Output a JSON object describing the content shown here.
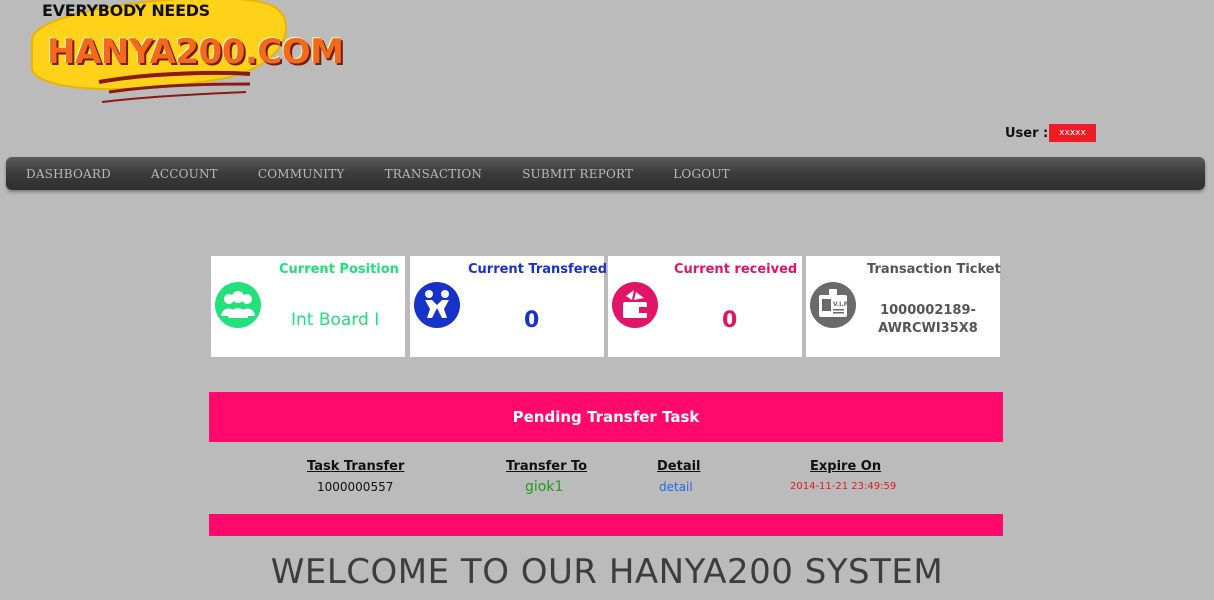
{
  "header": {
    "logo_tagline": "EVERYBODY NEEDS",
    "logo_word": "HANYA200.COM",
    "user_label": "User :",
    "user_name": "xxxxx"
  },
  "nav": {
    "items": [
      "DASHBOARD",
      "ACCOUNT",
      "COMMUNITY",
      "TRANSACTION",
      "SUBMIT REPORT",
      "LOGOUT"
    ]
  },
  "cards": [
    {
      "title": "Current Position",
      "value": "Int Board I",
      "icon": "group-icon",
      "color": "#22e07a"
    },
    {
      "title": "Current Transfered",
      "value": "0",
      "icon": "handshake-icon",
      "color": "#1632c8"
    },
    {
      "title": "Current received",
      "value": "0",
      "icon": "wallet-icon",
      "color": "#e21467"
    },
    {
      "title": "Transaction Ticket",
      "value_line1": "1000002189-",
      "value_line2": "AWRCWI35X8",
      "icon": "vip-card-icon",
      "color": "#555555"
    }
  ],
  "pending": {
    "title": "Pending Transfer Task",
    "headers": [
      "Task Transfer",
      "Transfer To",
      "Detail",
      "Expire On"
    ],
    "row": {
      "task_transfer": "1000000557",
      "transfer_to": "giok1",
      "detail": "detail",
      "expire_on": "2014-11-21 23:49:59"
    }
  },
  "welcome": "WELCOME TO OUR HANYA200 SYSTEM",
  "colors": {
    "accent": "#ff0a6c",
    "background": "#bcbbbc",
    "nav": "#3b3b3b"
  }
}
